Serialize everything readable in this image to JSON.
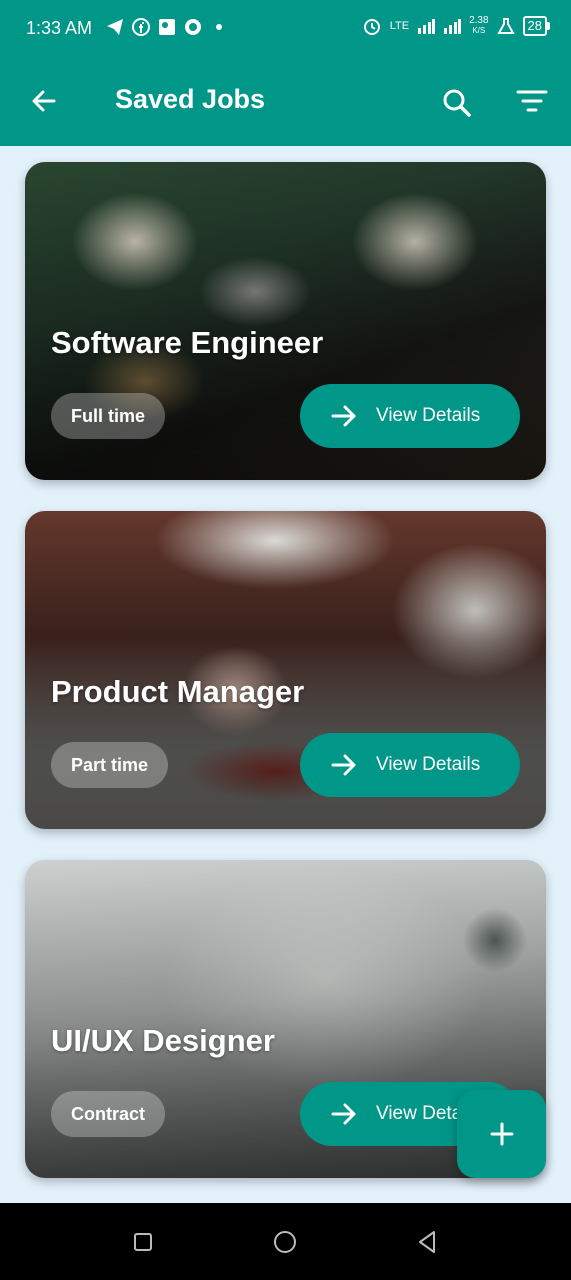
{
  "status_bar": {
    "time": "1:33 AM",
    "network": "LTE",
    "speed": "2.38",
    "speed_unit": "K/S",
    "battery": "28"
  },
  "app_bar": {
    "title": "Saved Jobs",
    "back_icon": "arrow-left-icon",
    "search_icon": "search-icon",
    "filter_icon": "filter-icon"
  },
  "jobs": [
    {
      "title": "Software Engineer",
      "type": "Full time",
      "action": "View Details"
    },
    {
      "title": "Product Manager",
      "type": "Part time",
      "action": "View Details"
    },
    {
      "title": "UI/UX Designer",
      "type": "Contract",
      "action": "View Details"
    }
  ],
  "fab": {
    "icon": "plus-icon"
  },
  "colors": {
    "primary": "#009688",
    "background": "#e3f1fb"
  }
}
